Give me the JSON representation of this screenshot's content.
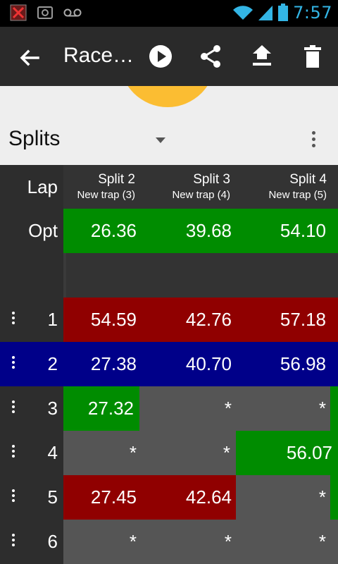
{
  "status_bar": {
    "time": "7:57",
    "icons": [
      "debug-x-icon",
      "screenshot-icon",
      "voicemail-icon",
      "wifi-icon",
      "signal-icon",
      "battery-icon"
    ]
  },
  "action_bar": {
    "title": "Race…",
    "icons": [
      "back-arrow-icon",
      "play-icon",
      "share-icon",
      "upload-icon",
      "delete-icon"
    ]
  },
  "section": {
    "label": "Splits"
  },
  "table": {
    "lap_header": "Lap",
    "columns": [
      {
        "title": "Split 2",
        "subtitle": "New trap (3)"
      },
      {
        "title": "Split 3",
        "subtitle": "New trap (4)"
      },
      {
        "title": "Split 4",
        "subtitle": "New trap (5)"
      }
    ],
    "opt_row": {
      "label": "Opt",
      "values": [
        "26.36",
        "39.68",
        "54.10"
      ]
    },
    "rows": [
      {
        "lap": "1",
        "values": [
          "54.59",
          "42.76",
          "57.18"
        ]
      },
      {
        "lap": "2",
        "values": [
          "27.38",
          "40.70",
          "56.98"
        ]
      },
      {
        "lap": "3",
        "values": [
          "27.32",
          "*",
          "*"
        ]
      },
      {
        "lap": "4",
        "values": [
          "*",
          "*",
          "56.07"
        ]
      },
      {
        "lap": "5",
        "values": [
          "27.45",
          "42.64",
          "*"
        ]
      },
      {
        "lap": "6",
        "values": [
          "*",
          "*",
          "*"
        ]
      }
    ]
  },
  "colors": {
    "green": "#008c00",
    "red": "#900000",
    "blue": "#000089",
    "gray": "#555555",
    "accent": "#fbbd32"
  }
}
